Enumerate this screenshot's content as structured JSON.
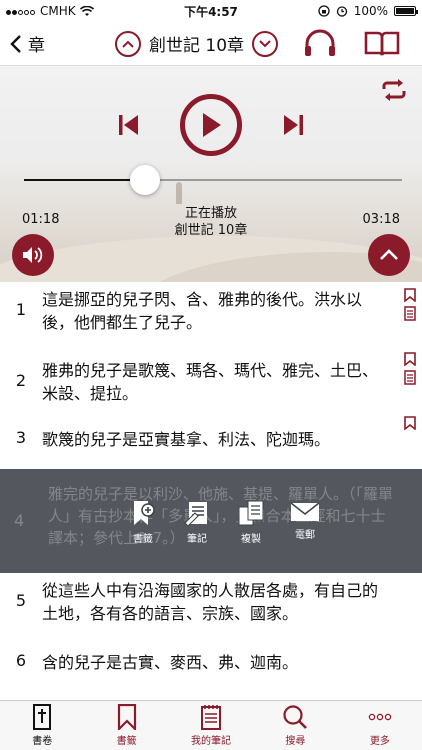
{
  "status_bar": {
    "carrier": "CMHK",
    "time": "下午4:57",
    "battery": "100%"
  },
  "nav": {
    "back_label": "章",
    "title": "創世記 10章"
  },
  "player": {
    "elapsed": "01:18",
    "duration": "03:18",
    "progress": 0.32,
    "now_playing_label": "正在播放",
    "now_playing_title": "創世記 10章"
  },
  "verses": [
    {
      "num": "1",
      "text": "這是挪亞的兒子閃、含、雅弗的後代。洪水以後，他們都生了兒子。",
      "bookmark": true,
      "note": true
    },
    {
      "num": "2",
      "text": "雅弗的兒子是歌篾、瑪各、瑪代、雅完、土巴、米設、提拉。",
      "bookmark": true,
      "note": true
    },
    {
      "num": "3",
      "text": "歌篾的兒子是亞實基拿、利法、陀迦瑪。",
      "bookmark": true,
      "note": false
    },
    {
      "num": "4",
      "text": "雅完的兒子是以利沙、他施、基提、羅單人。（「羅單人」有古抄本作「多單人」，見和合本；參代上1:7。）"
    },
    {
      "num": "5",
      "text": "從這些人中有沿海國家的人散居各處，有自己的土地，各有各的語言、宗族、國家。"
    },
    {
      "num": "6",
      "text": "含的兒子是古實、麥西、弗、迦南。"
    }
  ],
  "verse4_ghost": "雅完的兒子是以利沙、他施、基提、羅單人。（「羅單人」有古抄本作「多單人」，見和合本五經和七十士譯本；參代上1:7。）",
  "actions": [
    {
      "label": "書籤",
      "icon": "bookmark-add-icon"
    },
    {
      "label": "筆記",
      "icon": "note-icon"
    },
    {
      "label": "複製",
      "icon": "copy-icon"
    },
    {
      "label": "電郵",
      "icon": "mail-icon"
    }
  ],
  "tabs": [
    {
      "label": "書卷",
      "icon": "bible-icon",
      "active": true
    },
    {
      "label": "書籤",
      "icon": "bookmark-icon"
    },
    {
      "label": "我的筆記",
      "icon": "notes-icon"
    },
    {
      "label": "搜尋",
      "icon": "search-icon"
    },
    {
      "label": "更多",
      "icon": "more-icon"
    }
  ],
  "colors": {
    "accent": "#8b1a2b",
    "overlay": "#3c4048"
  }
}
